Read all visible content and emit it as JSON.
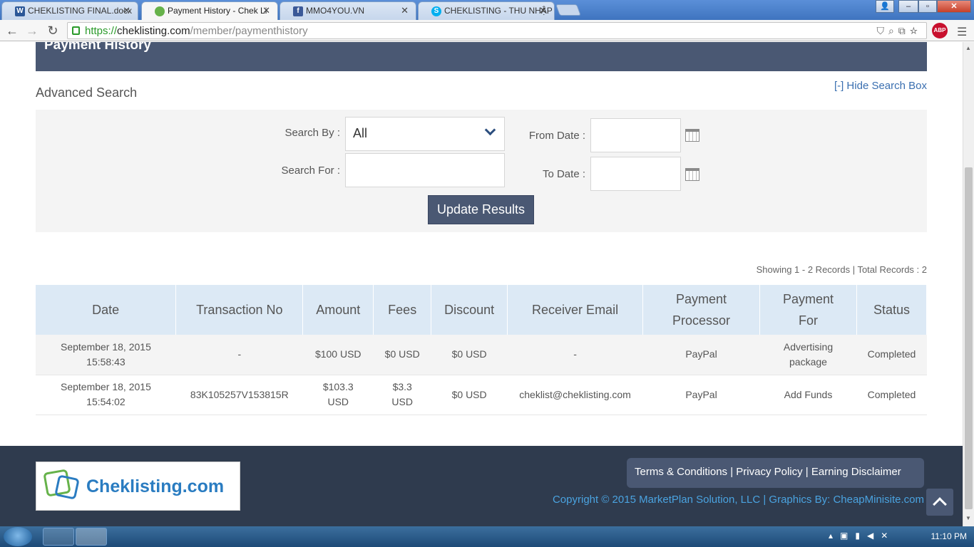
{
  "browser": {
    "tabs": [
      {
        "title": "CHEKLISTING FINAL.docx",
        "icon": "word-icon",
        "active": false
      },
      {
        "title": "Payment History - Chek Li",
        "icon": "cheklisting-icon",
        "active": true
      },
      {
        "title": "MMO4YOU.VN",
        "icon": "facebook-icon",
        "active": false
      },
      {
        "title": "CHEKLISTING - THU NHẬP",
        "icon": "skype-icon",
        "active": false
      }
    ],
    "url_scheme": "https://",
    "url_host": "cheklisting.com",
    "url_path": "/member/paymenthistory",
    "abp_label": "ABP"
  },
  "page": {
    "title": "Payment History",
    "advanced_search_title": "Advanced Search",
    "hide_search_link": "[-] Hide Search Box",
    "search": {
      "search_by_label": "Search By :",
      "search_by_value": "All",
      "search_for_label": "Search For :",
      "search_for_value": "",
      "from_date_label": "From Date :",
      "from_date_value": "",
      "to_date_label": "To Date :",
      "to_date_value": "",
      "update_button": "Update Results"
    },
    "records_summary": "Showing 1 - 2 Records | Total Records : 2",
    "table": {
      "headers": [
        "Date",
        "Transaction No",
        "Amount",
        "Fees",
        "Discount",
        "Receiver Email",
        "Payment Processor",
        "Payment For",
        "Status"
      ],
      "rows": [
        [
          "September 18, 2015 15:58:43",
          "-",
          "$100 USD",
          "$0 USD",
          "$0 USD",
          "-",
          "PayPal",
          "Advertising package",
          "Completed"
        ],
        [
          "September 18, 2015 15:54:02",
          "83K105257V153815R",
          "$103.3 USD",
          "$3.3 USD",
          "$0 USD",
          "cheklist@cheklisting.com",
          "PayPal",
          "Add Funds",
          "Completed"
        ]
      ]
    },
    "footer": {
      "logo_text": "Cheklisting.com",
      "links": "Terms & Conditions | Privacy Policy | Earning Disclaimer",
      "copyright": "Copyright © 2015 MarketPlan Solution, LLC | Graphics By: CheapMinisite.com"
    }
  },
  "taskbar": {
    "clock": "11:10 PM"
  },
  "colors": {
    "header_bg": "#4a5873",
    "table_header_bg": "#dce9f5",
    "link": "#3a6fb0",
    "footer_bg": "#2f3b4e"
  }
}
